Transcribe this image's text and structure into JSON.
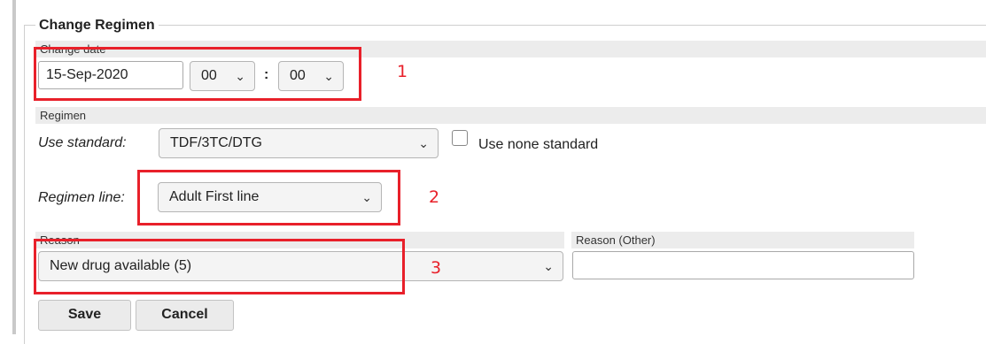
{
  "legend": "Change Regimen",
  "change_date": {
    "section_label": "Change date",
    "date_value": "15-Sep-2020",
    "hour_value": "00",
    "minute_value": "00",
    "separator": ":"
  },
  "regimen": {
    "section_label": "Regimen",
    "use_standard_label": "Use standard:",
    "use_standard_value": "TDF/3TC/DTG",
    "use_none_standard_label": "Use none standard",
    "regimen_line_label": "Regimen line:",
    "regimen_line_value": "Adult First line"
  },
  "reason": {
    "section_label": "Reason",
    "value": "New drug available (5)",
    "other_label": "Reason (Other)",
    "other_value": ""
  },
  "buttons": {
    "save": "Save",
    "cancel": "Cancel"
  },
  "annotations": {
    "one": "1",
    "two": "2",
    "three": "3"
  },
  "icons": {
    "caret": "chevron-down-icon"
  },
  "colors": {
    "annotation": "#e8202a"
  }
}
